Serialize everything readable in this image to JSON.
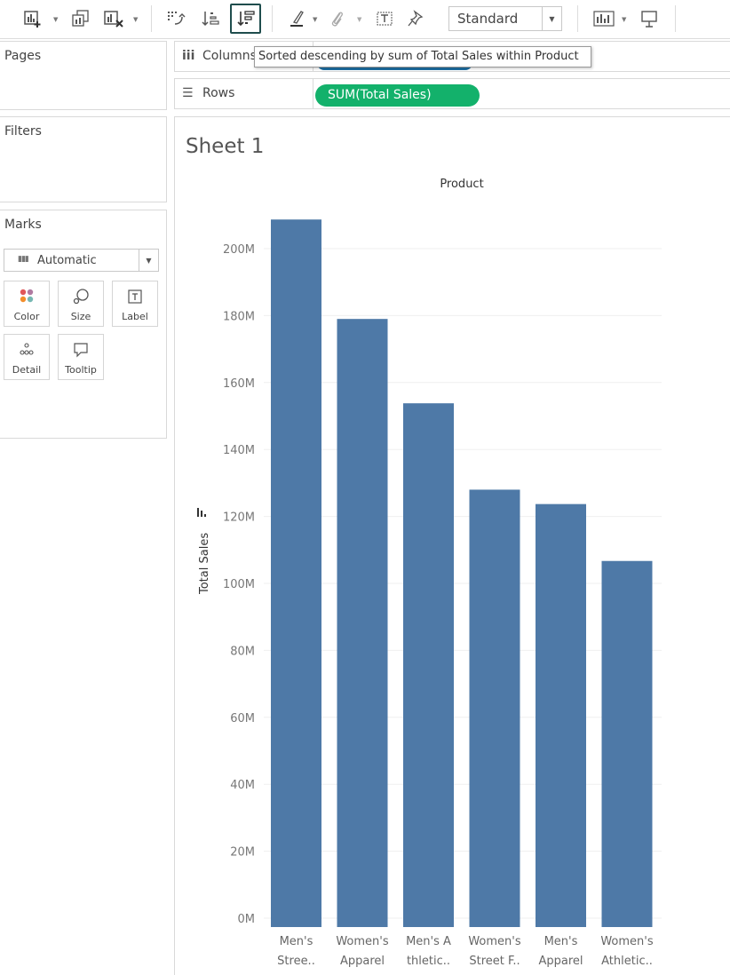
{
  "toolbar": {
    "fit_select_value": "Standard",
    "icons": [
      "new-worksheet-icon",
      "duplicate-icon",
      "clear-sheet-icon",
      "swap-axes-icon",
      "sort-ascending-icon",
      "sort-descending-icon",
      "highlight-icon",
      "group-icon",
      "show-labels-icon",
      "fix-axes-icon",
      "show-me-icon",
      "presentation-icon"
    ]
  },
  "tooltip": {
    "text": "Sorted descending by sum of Total Sales within Product"
  },
  "panels": {
    "pages": "Pages",
    "filters": "Filters",
    "marks": {
      "title": "Marks",
      "type": "Automatic",
      "buttons": [
        "Color",
        "Size",
        "Label",
        "Detail",
        "Tooltip"
      ]
    }
  },
  "shelves": {
    "columns_label": "Columns",
    "rows_label": "Rows",
    "rows_pill": "SUM(Total Sales)"
  },
  "sheet": {
    "title": "Sheet 1"
  },
  "chart_data": {
    "type": "bar",
    "title": "Product",
    "xlabel": "",
    "ylabel": "Total Sales",
    "categories": [
      [
        "Men's",
        "Stree.."
      ],
      [
        "Women's",
        "Apparel"
      ],
      [
        "Men's A",
        "thletic.."
      ],
      [
        "Women's",
        "Street F.."
      ],
      [
        "Men's",
        "Apparel"
      ],
      [
        "Women's",
        "Athletic.."
      ]
    ],
    "values": [
      208.7,
      179.0,
      153.8,
      128.0,
      123.7,
      106.7
    ],
    "unit": "M",
    "ylim": [
      0,
      220
    ],
    "yticks": [
      "0M",
      "20M",
      "40M",
      "60M",
      "80M",
      "100M",
      "120M",
      "140M",
      "160M",
      "180M",
      "200M"
    ],
    "ytick_values": [
      0,
      20,
      40,
      60,
      80,
      100,
      120,
      140,
      160,
      180,
      200
    ],
    "grid": true,
    "bar_color": "#4e79a7"
  }
}
